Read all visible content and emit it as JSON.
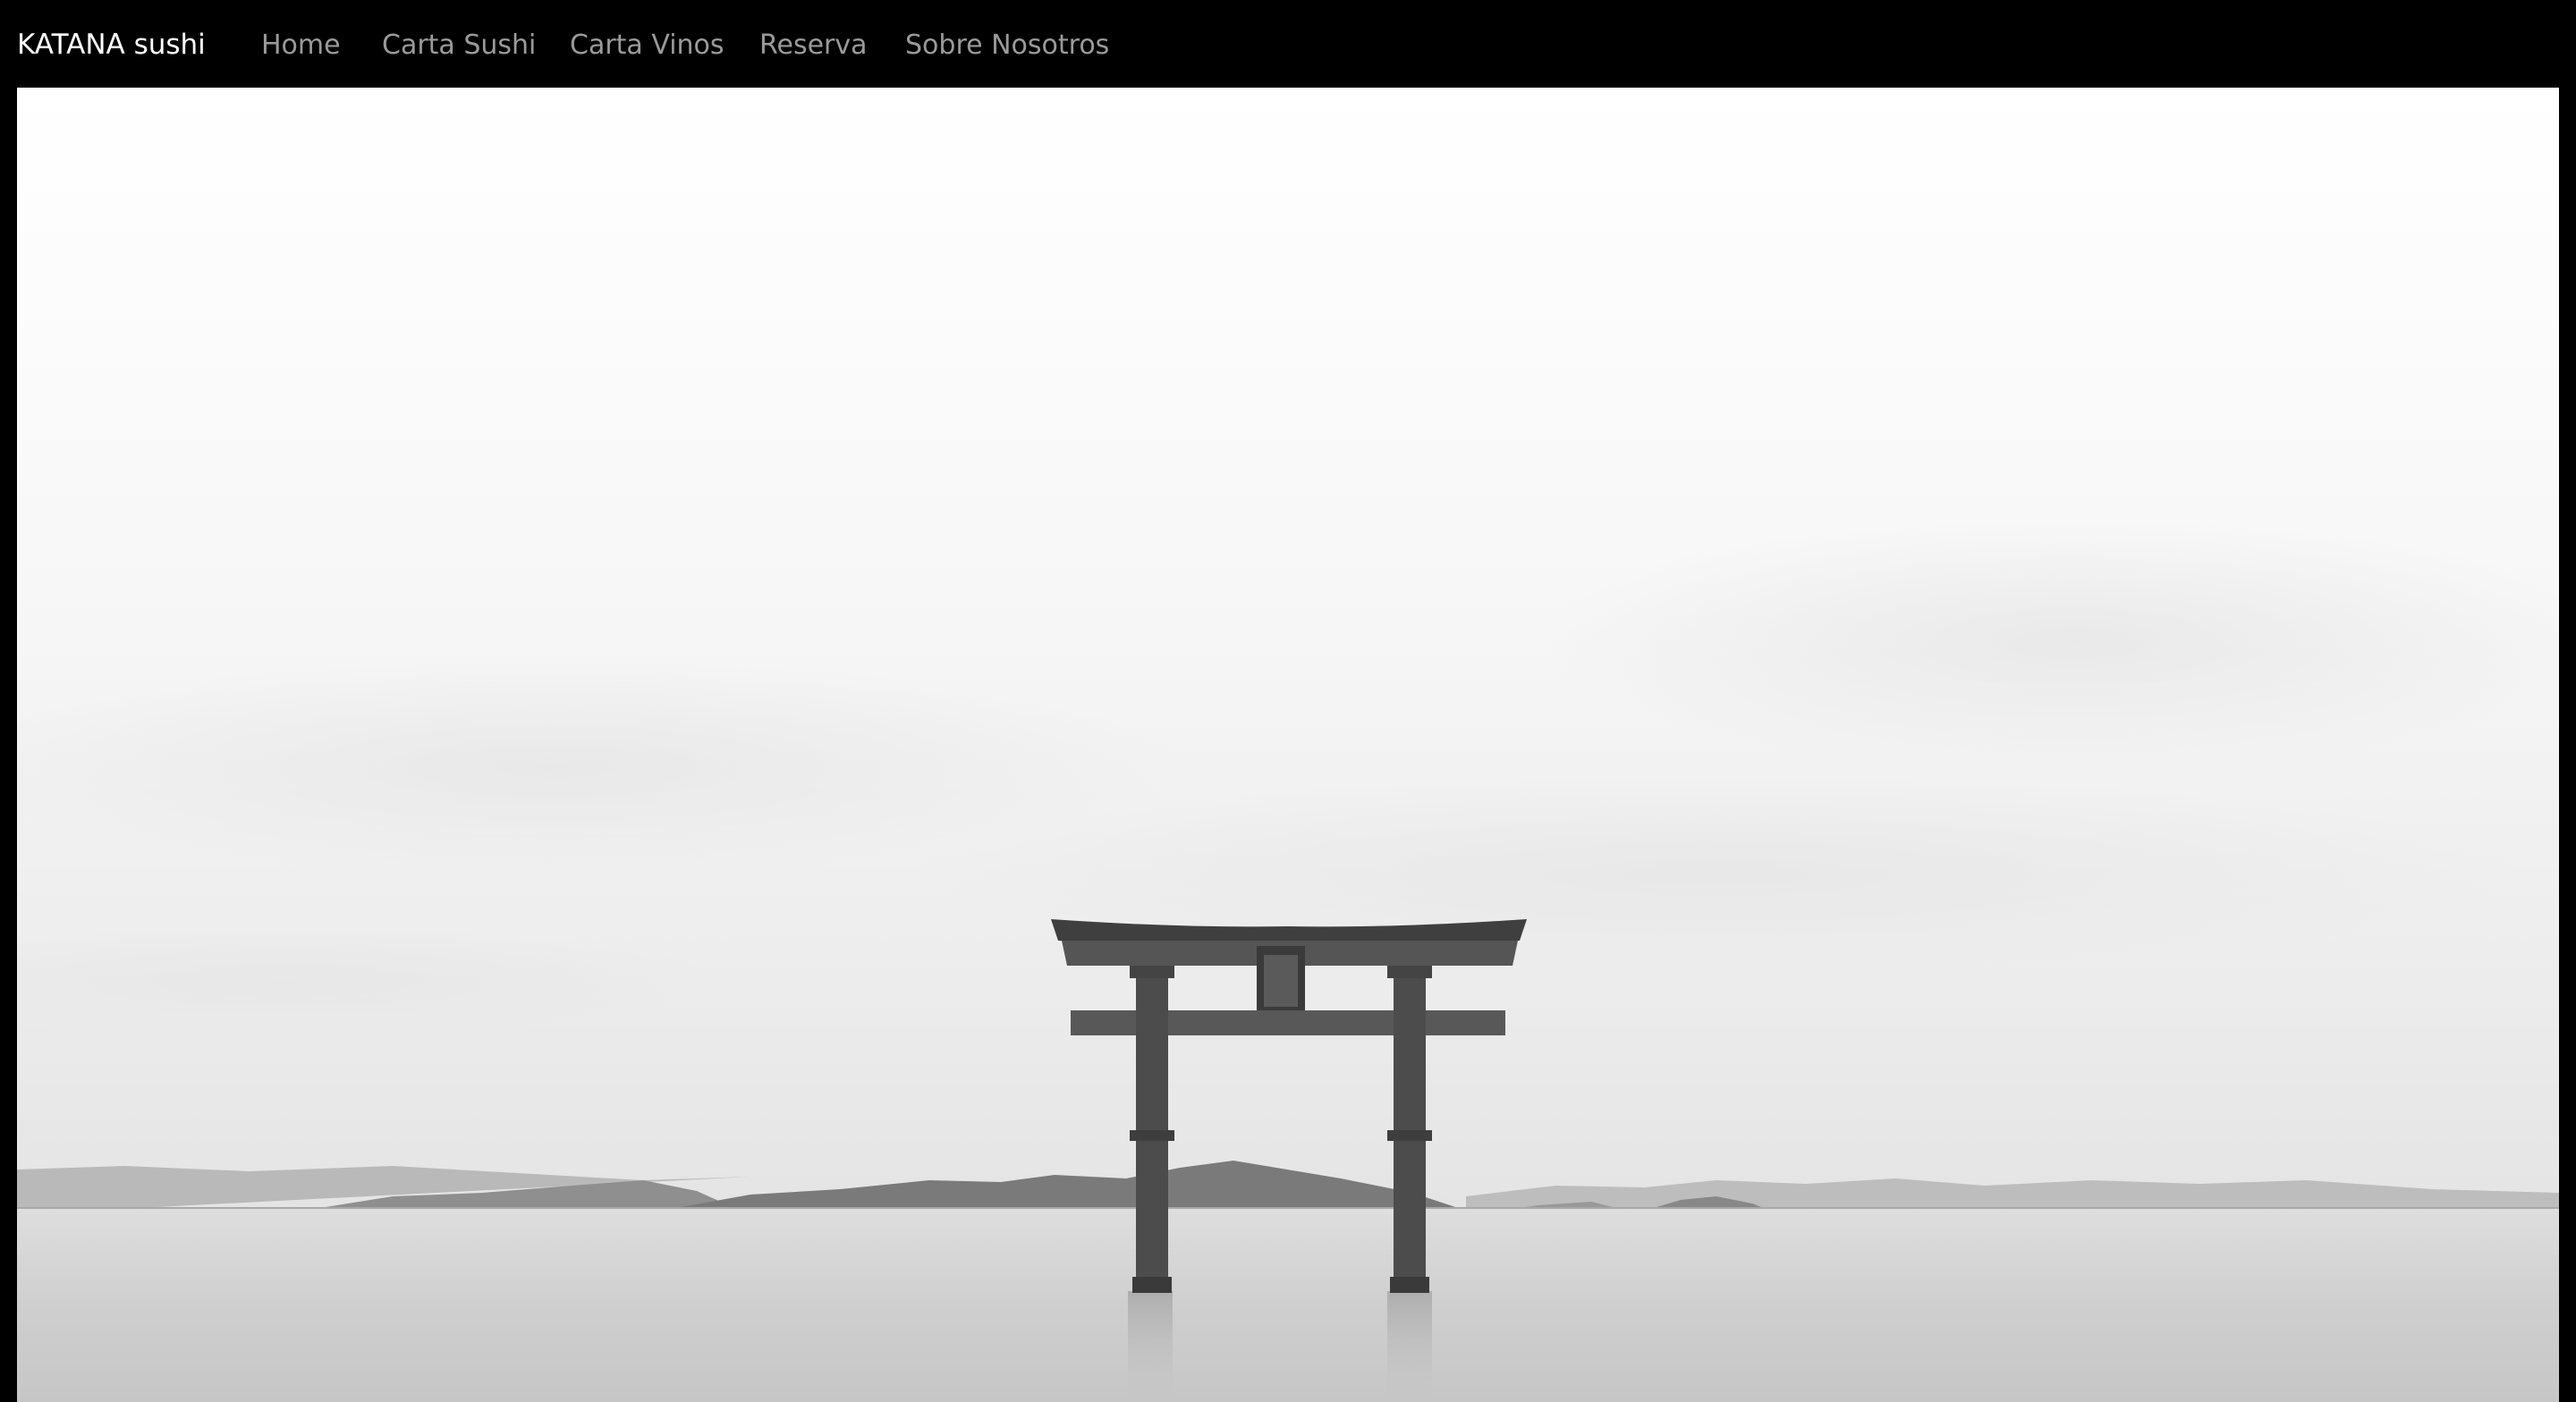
{
  "navbar": {
    "brand": "KATANA sushi",
    "links": [
      {
        "label": "Home"
      },
      {
        "label": "Carta Sushi"
      },
      {
        "label": "Carta Vinos"
      },
      {
        "label": "Reserva"
      },
      {
        "label": "Sobre Nosotros"
      }
    ]
  },
  "colors": {
    "navbar_background": "#000000",
    "brand_text": "#ffffff",
    "link_text": "#9a9a9a"
  },
  "hero": {
    "image": "torii-gate-in-lake-photo"
  }
}
